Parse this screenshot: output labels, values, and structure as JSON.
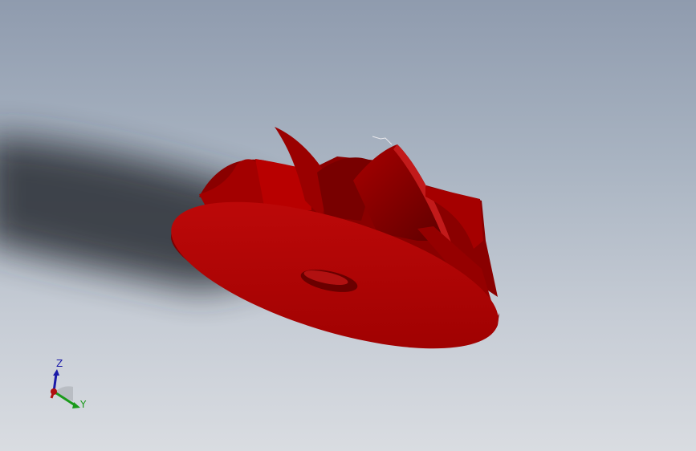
{
  "viewport": {
    "background_top": "#8f9bae",
    "background_bottom": "#d9dce1",
    "model_color": "#b00000",
    "model_shadow_color": "#6a0000"
  },
  "triad": {
    "z_label": "Z",
    "y_label": "Y",
    "z_color": "#1a1aa8",
    "y_color": "#1a9a1a",
    "x_color": "#b01010"
  }
}
